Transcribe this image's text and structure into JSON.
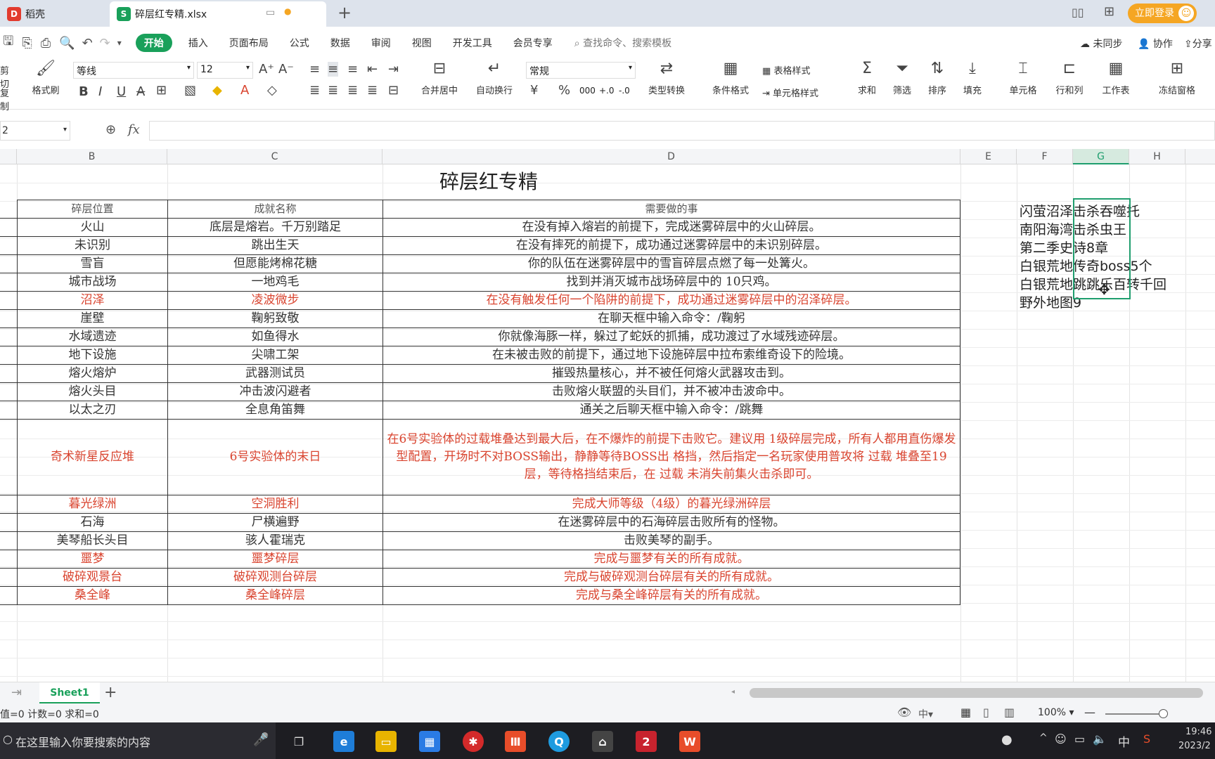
{
  "titlebar": {
    "tab1": "稻壳",
    "tab2": "碎层红专精.xlsx",
    "login": "立即登录"
  },
  "menu": [
    "开始",
    "插入",
    "页面布局",
    "公式",
    "数据",
    "审阅",
    "视图",
    "开发工具",
    "会员专享"
  ],
  "search_placeholder": "查找命令、搜索模板",
  "right_actions": {
    "sync": "未同步",
    "collab": "协作",
    "share": "分享"
  },
  "ribbon": {
    "cut": "剪切",
    "copy": "复制",
    "format_painter": "格式刷",
    "font_name": "等线",
    "font_size": "12",
    "merge": "合并居中",
    "wrap": "自动换行",
    "number_format": "常规",
    "convert": "类型转换",
    "cond_format": "条件格式",
    "table_style": "表格样式",
    "cell_style": "单元格样式",
    "sum": "求和",
    "filter": "筛选",
    "sort": "排序",
    "fill": "填充",
    "cell": "单元格",
    "row_col": "行和列",
    "worksheet": "工作表",
    "freeze": "冻结窗格"
  },
  "formula_bar": {
    "cell_ref": "2",
    "fx": "fx",
    "content": ""
  },
  "columns": [
    "B",
    "C",
    "D",
    "E",
    "F",
    "G",
    "H"
  ],
  "sheet_title": "碎层红专精",
  "table": {
    "headers": [
      "碎层位置",
      "成就名称",
      "需要做的事"
    ],
    "rows": [
      {
        "loc": "火山",
        "name": "底层是熔岩。千万别踏足",
        "task": "在没有掉入熔岩的前提下，完成迷雾碎层中的火山碎层。",
        "red": false
      },
      {
        "loc": "未识别",
        "name": "跳出生天",
        "task": "在没有摔死的前提下，成功通过迷雾碎层中的未识别碎层。",
        "red": false
      },
      {
        "loc": "雪盲",
        "name": "但愿能烤棉花糖",
        "task": "你的队伍在迷雾碎层中的雪盲碎层点燃了每一处篝火。",
        "red": false
      },
      {
        "loc": "城市战场",
        "name": "一地鸡毛",
        "task": "找到并消灭城市战场碎层中的 10只鸡。",
        "red": false
      },
      {
        "loc": "沼泽",
        "name": "凌波微步",
        "task": "在没有触发任何一个陷阱的前提下，成功通过迷雾碎层中的沼泽碎层。",
        "red": true
      },
      {
        "loc": "崖壁",
        "name": "鞠躬致敬",
        "task": "在聊天框中输入命令：/鞠躬",
        "red": false
      },
      {
        "loc": "水域遗迹",
        "name": "如鱼得水",
        "task": "你就像海豚一样，躲过了蛇妖的抓捕，成功渡过了水域残迹碎层。",
        "red": false
      },
      {
        "loc": "地下设施",
        "name": "尖啸工架",
        "task": "在未被击败的前提下，通过地下设施碎层中拉布索维奇设下的险境。",
        "red": false
      },
      {
        "loc": "熔火熔炉",
        "name": "武器测试员",
        "task": "摧毁热量核心，并不被任何熔火武器攻击到。",
        "red": false
      },
      {
        "loc": "熔火头目",
        "name": "冲击波闪避者",
        "task": "击败熔火联盟的头目们，并不被冲击波命中。",
        "red": false
      },
      {
        "loc": "以太之刃",
        "name": "全息角笛舞",
        "task": "通关之后聊天框中输入命令：/跳舞",
        "red": false
      },
      {
        "loc": "奇术新星反应堆",
        "name": "6号实验体的末日",
        "task": "在6号实验体的过载堆叠达到最大后，在不爆炸的前提下击败它。建议用 1级碎层完成，所有人都用直伤爆发型配置，开场时不对BOSS输出，静静等待BOSS出 格挡，然后指定一名玩家使用普攻将 过载 堆叠至19层，等待格挡结束后，在 过载 未消失前集火击杀即可。",
        "red": true
      },
      {
        "loc": "暮光绿洲",
        "name": "空洞胜利",
        "task": "完成大师等级（4级）的暮光绿洲碎层",
        "red": true
      },
      {
        "loc": "石海",
        "name": "尸横遍野",
        "task": "在迷雾碎层中的石海碎层击败所有的怪物。",
        "red": false
      },
      {
        "loc": "美琴船长头目",
        "name": "骇人霍瑞克",
        "task": "击败美琴的副手。",
        "red": false
      },
      {
        "loc": "噩梦",
        "name": "噩梦碎层",
        "task": "完成与噩梦有关的所有成就。",
        "red": true
      },
      {
        "loc": "破碎观景台",
        "name": "破碎观测台碎层",
        "task": "完成与破碎观测台碎层有关的所有成就。",
        "red": true
      },
      {
        "loc": "桑全峰",
        "name": "桑全峰碎层",
        "task": "完成与桑全峰碎层有关的所有成就。",
        "red": true
      }
    ]
  },
  "notes": [
    {
      "text": "闪萤沼泽击杀吞噬托",
      "red": false
    },
    {
      "text": "南阳海湾击杀虫王",
      "red": false
    },
    {
      "text": "第二季史诗8章",
      "red": false
    },
    {
      "text": "白银荒地传奇boss5个",
      "red": false
    },
    {
      "text": "白银荒地跳跳乐百转千回",
      "red": false
    },
    {
      "text": "野外地图9",
      "red": true
    }
  ],
  "sheet_tab": "Sheet1",
  "status": {
    "stats": "值=0 计数=0 求和=0",
    "zoom": "100%"
  },
  "taskbar": {
    "search": "在这里输入你要搜索的内容",
    "time": "19:46",
    "date": "2023/2",
    "ime": "中"
  },
  "colors": {
    "accent": "#19a05a",
    "red_text": "#d9442f",
    "selection": "#1f9e6e",
    "login": "#f5a623"
  }
}
